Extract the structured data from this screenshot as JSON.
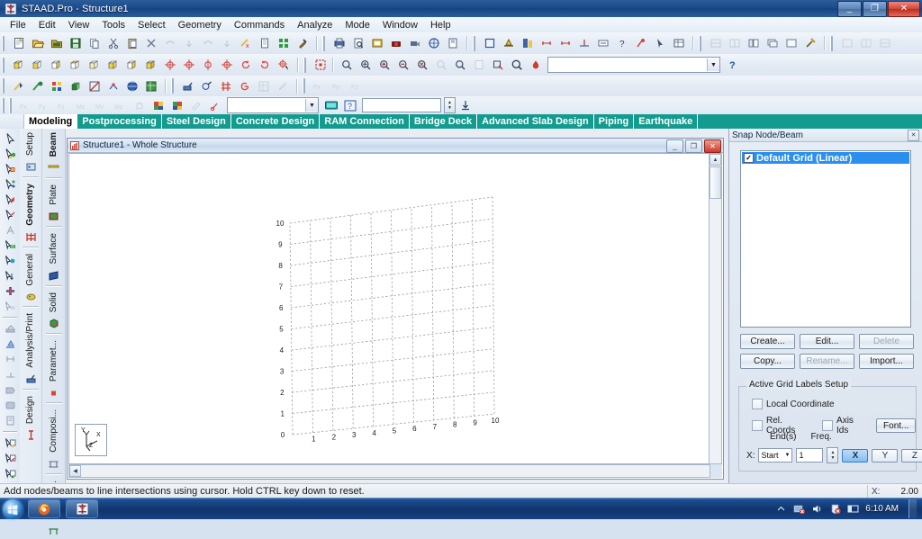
{
  "window": {
    "title": "STAAD.Pro - Structure1",
    "app_icon": "staad-icon",
    "minimize": "–",
    "maximize": "❐",
    "close": "✕"
  },
  "menu": {
    "items": [
      "File",
      "Edit",
      "View",
      "Tools",
      "Select",
      "Geometry",
      "Commands",
      "Analyze",
      "Mode",
      "Window",
      "Help"
    ]
  },
  "toolbars": {
    "row1": {
      "group1": [
        "new-file-icon",
        "open-file-icon",
        "open-folder-icon",
        "save-icon",
        "copy-icon",
        "cut-icon",
        "paste-icon",
        "delete-icon",
        "undo-icon",
        "undo-down-icon",
        "redo-icon",
        "redo-down-icon",
        "run-analysis-icon",
        "report-icon",
        "snap-grid-icon",
        "tools-icon"
      ],
      "group2": [
        "print-icon",
        "print-preview-icon",
        "picture-icon",
        "camera-icon",
        "video-icon",
        "plot-icon",
        "page-setup-icon"
      ],
      "group3": [
        "window-icon",
        "scale-icon",
        "diagram-icon",
        "dim-icon",
        "node-icon",
        "support-icon",
        "label-icon",
        "help-arrow-icon",
        "query-icon",
        "pointer-icon",
        "table-icon"
      ],
      "group4": [
        "zoom-all-icon",
        "symbol-icon",
        "display-icon"
      ],
      "group5": [
        "split-h-icon",
        "split-v-icon",
        "tile-icon",
        "cascade-icon",
        "arrange-icon"
      ],
      "group6": [
        "layout1-icon",
        "layout2-icon",
        "layout3-icon"
      ]
    },
    "row2": {
      "views": [
        "iso-view-icon",
        "front-view-icon",
        "back-view-icon",
        "top-view-icon",
        "bottom-view-icon",
        "left-view-icon",
        "right-view-icon",
        "3d-view-icon"
      ],
      "rotations": [
        "rotate-up-icon",
        "rotate-down-icon",
        "rotate-x-icon",
        "rotate-y-icon",
        "rotate-ccw-icon",
        "rotate-cw-icon",
        "rotate-free-icon"
      ],
      "zoom": [
        "zoom-window-icon",
        "zoom-in-icon",
        "zoom-out-icon",
        "zoom-dynamic-icon",
        "zoom-extents-icon",
        "pan-icon",
        "zoom-previous-icon",
        "zoom-page-icon",
        "zoom-select-icon",
        "zoom-glass-icon",
        "shade-icon"
      ],
      "combo_value": "",
      "help_icon": "help-icon"
    },
    "row3": {
      "group1": [
        "render-icon",
        "color-icon",
        "structure-icon",
        "solid-render-icon",
        "section-icon",
        "node-display-icon",
        "globe-icon",
        "table-view-icon"
      ],
      "group2": [
        "measure-icon",
        "select-circle-icon",
        "beam-icon",
        "rotate-sel-icon",
        "grid-table-icon",
        "line-icon"
      ],
      "group3": [
        "r1-icon",
        "r2-icon",
        "r3-icon"
      ]
    },
    "row4": {
      "group1": [
        "fx-icon",
        "fy-icon",
        "fz-icon",
        "mx-icon",
        "my-icon",
        "mz-icon",
        "hand-icon",
        "color1-icon",
        "color2-icon",
        "paint-icon",
        "pick-icon"
      ],
      "combo_value": "",
      "display_icon": "display-toggle-icon",
      "help_icon": "context-help-icon",
      "textbox_value": "",
      "spin_icon": "spinner-icon",
      "down_icon": "download-icon"
    }
  },
  "mode_tabs": [
    {
      "label": "Modeling",
      "active": true
    },
    {
      "label": "Postprocessing",
      "active": false
    },
    {
      "label": "Steel Design",
      "active": false
    },
    {
      "label": "Concrete Design",
      "active": false
    },
    {
      "label": "RAM Connection",
      "active": false
    },
    {
      "label": "Bridge Deck",
      "active": false
    },
    {
      "label": "Advanced Slab Design",
      "active": false
    },
    {
      "label": "Piping",
      "active": false
    },
    {
      "label": "Earthquake",
      "active": false
    }
  ],
  "left_toolbar": {
    "items": [
      "cursor-icon",
      "node-cursor-icon",
      "beam-cursor-icon",
      "plate-cursor-icon",
      "solid-cursor-icon",
      "geometry-cursor-icon",
      "text-cursor-icon",
      "dimension-icon",
      "support-cursor-icon",
      "load-cursor-icon",
      "add-icon",
      "surface-cursor-icon",
      "translate-icon",
      "mirror-icon",
      "rotate-icon",
      "extend-icon",
      "break-icon",
      "fillet-icon",
      "shape-icon",
      "note-icon",
      "select-group1-icon",
      "select-group2-icon",
      "select-group3-icon",
      "select-group4-icon"
    ]
  },
  "side_strip": {
    "column_left": [
      {
        "label": "Setup",
        "icon": "setup-icon",
        "active": false
      },
      {
        "label": "Geometry",
        "icon": "geometry-icon",
        "active": true
      },
      {
        "label": "General",
        "icon": "general-icon",
        "active": false
      },
      {
        "label": "Analysis/Print",
        "icon": "analysis-print-icon",
        "active": false
      },
      {
        "label": "Design",
        "icon": "design-icon",
        "active": false
      }
    ],
    "column_right": [
      {
        "label": "Beam",
        "icon": "beam-strip-icon",
        "active": true
      },
      {
        "label": "Plate",
        "icon": "plate-strip-icon",
        "active": false
      },
      {
        "label": "Surface",
        "icon": "surface-strip-icon",
        "active": false
      },
      {
        "label": "Solid",
        "icon": "solid-strip-icon",
        "active": false
      },
      {
        "label": "Paramet...",
        "icon": "parametric-strip-icon",
        "active": false
      },
      {
        "label": "Composi...",
        "icon": "composite-strip-icon",
        "active": false
      },
      {
        "label": "Physica...",
        "icon": "physical-strip-icon",
        "active": false
      }
    ]
  },
  "mdi": {
    "title": "Structure1 - Whole Structure",
    "icon": "structure-icon",
    "minimize": "–",
    "maximize": "❐",
    "close": "✕"
  },
  "canvas": {
    "axis_triad": {
      "y": "Y",
      "x": "X",
      "z": "Z"
    },
    "grid": {
      "divisions": 10,
      "line_color": "#9a9a9a",
      "style": "dashed",
      "x_labels": [
        "0",
        "1",
        "2",
        "3",
        "4",
        "5",
        "6",
        "7",
        "8",
        "9",
        "10"
      ],
      "y_labels": [
        "0",
        "1",
        "2",
        "3",
        "4",
        "5",
        "6",
        "7",
        "8",
        "9",
        "10"
      ]
    }
  },
  "dock": {
    "title": "Snap Node/Beam",
    "close": "✕",
    "grid_list": [
      {
        "label": "Default Grid (Linear)",
        "checked": true,
        "selected": true
      }
    ],
    "buttons": [
      {
        "label": "Create...",
        "enabled": true
      },
      {
        "label": "Edit...",
        "enabled": true
      },
      {
        "label": "Delete",
        "enabled": false
      },
      {
        "label": "Copy...",
        "enabled": true
      },
      {
        "label": "Rename...",
        "enabled": false
      },
      {
        "label": "Import...",
        "enabled": true
      }
    ],
    "labels_group": {
      "legend": "Active Grid Labels Setup",
      "local_coordinate": {
        "label": "Local Coordinate",
        "checked": false
      },
      "rel_coords": {
        "label": "Rel. Coords",
        "checked": false
      },
      "axis_ids": {
        "label": "Axis Ids",
        "checked": false
      },
      "font_button": "Font...",
      "col_ends": "End(s)",
      "col_freq": "Freq.",
      "axis_row_label": "X:",
      "start_select": "Start",
      "freq_value": "1",
      "axis_buttons": [
        {
          "label": "X",
          "selected": true
        },
        {
          "label": "Y",
          "selected": false
        },
        {
          "label": "Z",
          "selected": false
        }
      ]
    }
  },
  "statusbar": {
    "message": "Add nodes/beams to line intersections using cursor. Hold CTRL key down to reset.",
    "coord_label": "X:",
    "coord_value": "2.00"
  },
  "taskbar": {
    "start": "start-orb",
    "apps": [
      {
        "name": "firefox-icon"
      },
      {
        "name": "staad-icon"
      }
    ],
    "tray": [
      "show-hidden-icon",
      "network-icon",
      "volume-icon",
      "action-center-icon",
      "display-icon"
    ],
    "clock": "6:10 AM"
  },
  "colors": {
    "titlebar": "#1c4c89",
    "mode_tab_bar": "#129b8e",
    "selection": "#2a8fee",
    "grid_line": "#9a9a9a",
    "taskbar": "#10346b"
  }
}
